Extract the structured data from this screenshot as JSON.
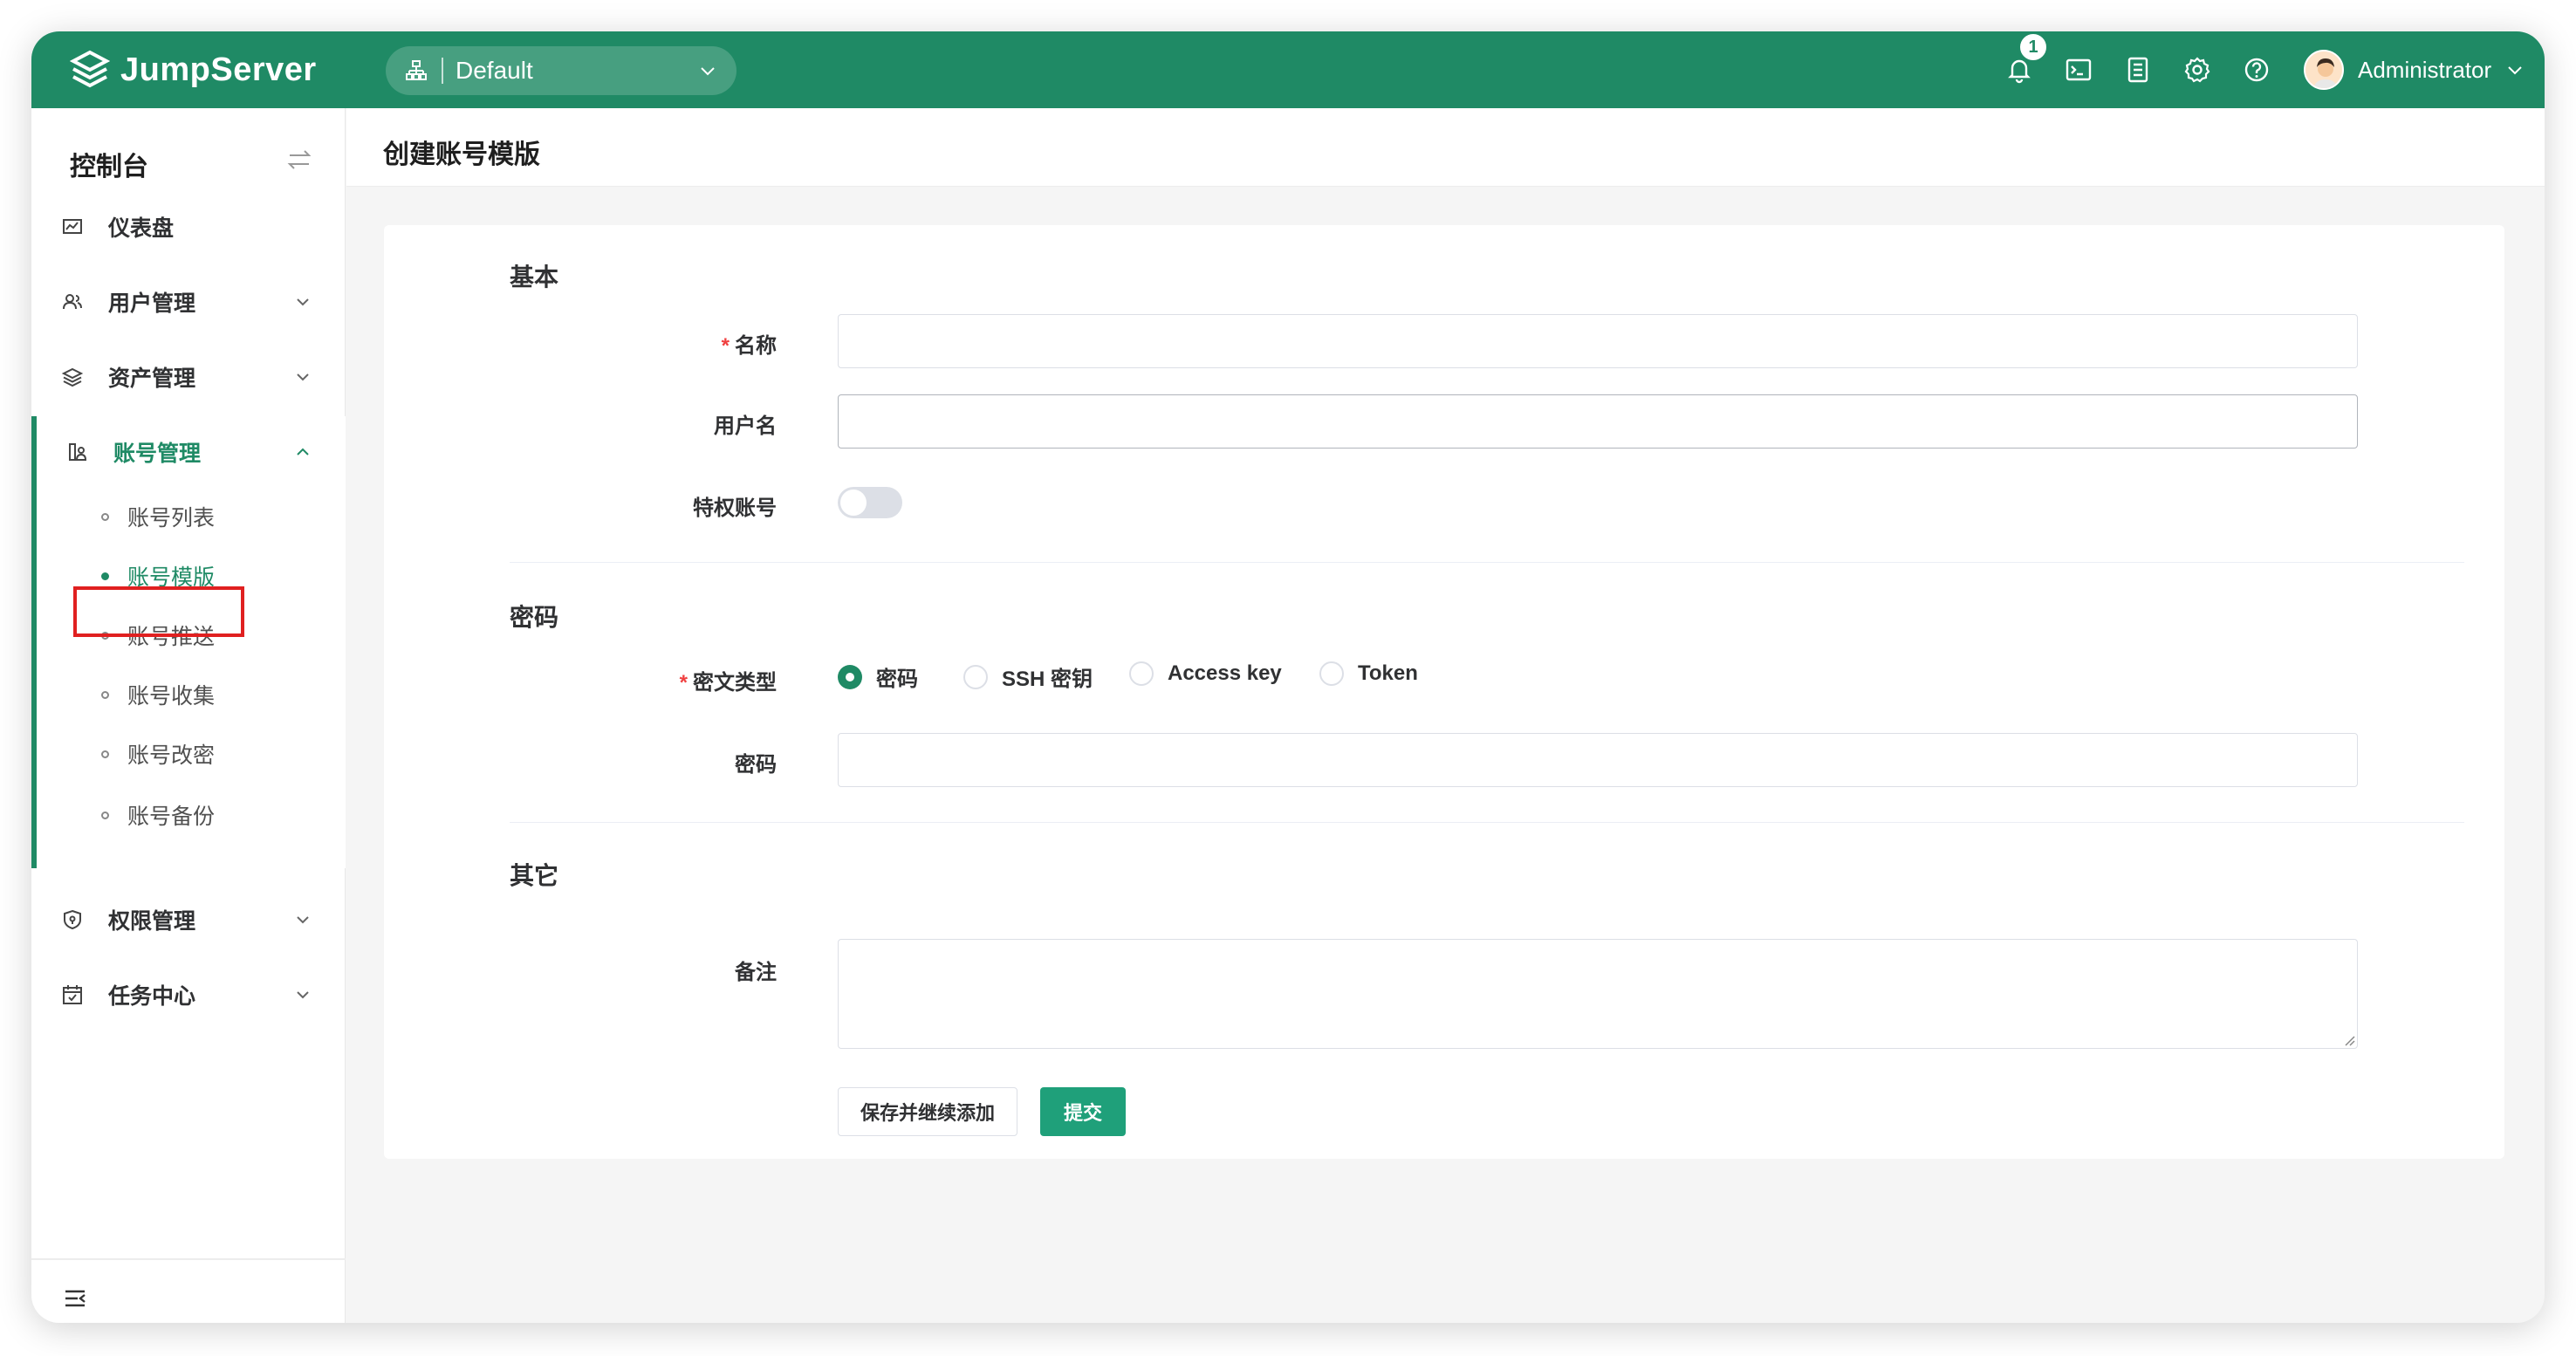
{
  "topbar": {
    "brand": "JumpServer",
    "org": "Default",
    "notification_count": "1",
    "user_name": "Administrator",
    "icons": [
      "bell-icon",
      "terminal-icon",
      "list-icon",
      "gear-icon",
      "help-icon"
    ]
  },
  "sidebar": {
    "title": "控制台",
    "items": [
      {
        "label": "仪表盘",
        "icon": "dashboard-icon"
      },
      {
        "label": "用户管理",
        "icon": "users-icon"
      },
      {
        "label": "资产管理",
        "icon": "layers-icon"
      },
      {
        "label": "账号管理",
        "icon": "account-icon"
      },
      {
        "label": "权限管理",
        "icon": "shield-icon"
      },
      {
        "label": "任务中心",
        "icon": "calendar-icon"
      }
    ],
    "sub_items": [
      "账号列表",
      "账号模版",
      "账号推送",
      "账号收集",
      "账号改密",
      "账号备份"
    ],
    "active_sub": "账号模版"
  },
  "page": {
    "title": "创建账号模版"
  },
  "form": {
    "sections": {
      "basic": "基本",
      "secret": "密码",
      "other": "其它"
    },
    "fields": {
      "name": "名称",
      "username": "用户名",
      "privileged": "特权账号",
      "secret_type": "密文类型",
      "secret": "密码",
      "comment": "备注"
    },
    "secret_types": [
      "密码",
      "SSH 密钥",
      "Access key",
      "Token"
    ],
    "selected_secret_type": "密码",
    "privileged_enabled": false,
    "buttons": {
      "save_continue": "保存并继续添加",
      "submit": "提交"
    }
  },
  "colors": {
    "brand": "#1f8a65",
    "primary_button": "#1fa07a",
    "required": "#f04040"
  }
}
